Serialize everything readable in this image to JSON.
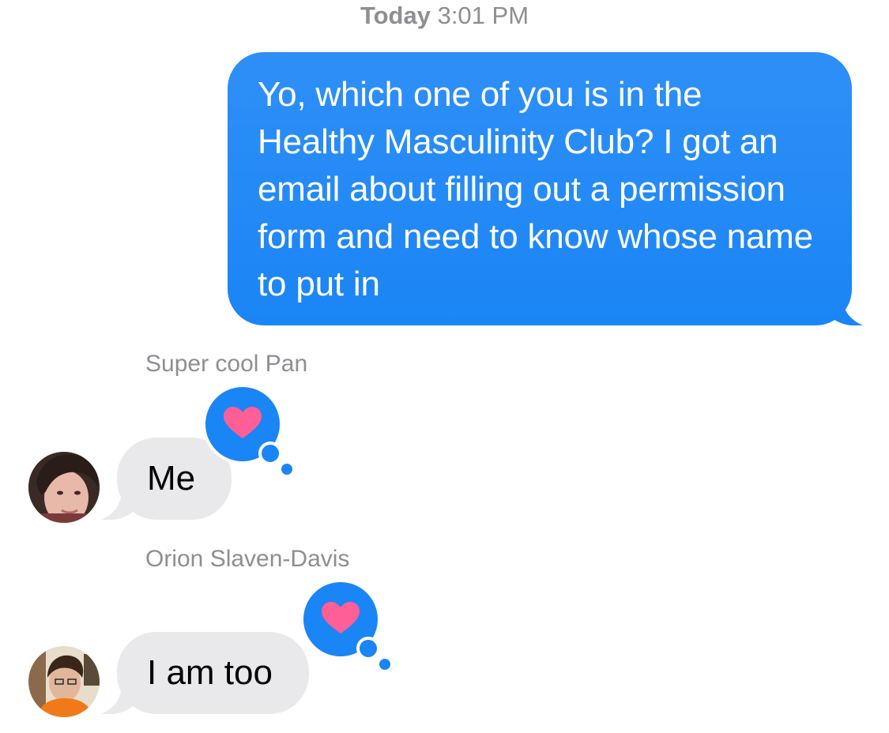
{
  "header": {
    "day": "Today",
    "time": "3:01 PM"
  },
  "messages": {
    "outgoing": {
      "text": "Yo, which one of you is in the Healthy Masculinity Club? I got an email about filling out a permission form and need to know whose name to put in"
    },
    "incoming": [
      {
        "sender": "Super cool Pan",
        "text": "Me",
        "reaction": "heart-icon"
      },
      {
        "sender": "Orion Slaven-Davis",
        "text": "I am too",
        "reaction": "heart-icon"
      }
    ]
  },
  "colors": {
    "outgoing_bubble": "#1a85f5",
    "incoming_bubble": "#e9e9eb",
    "tapback_bubble": "#1a85f5",
    "heart": "#ff5e97",
    "meta_text": "#8e8e93"
  }
}
